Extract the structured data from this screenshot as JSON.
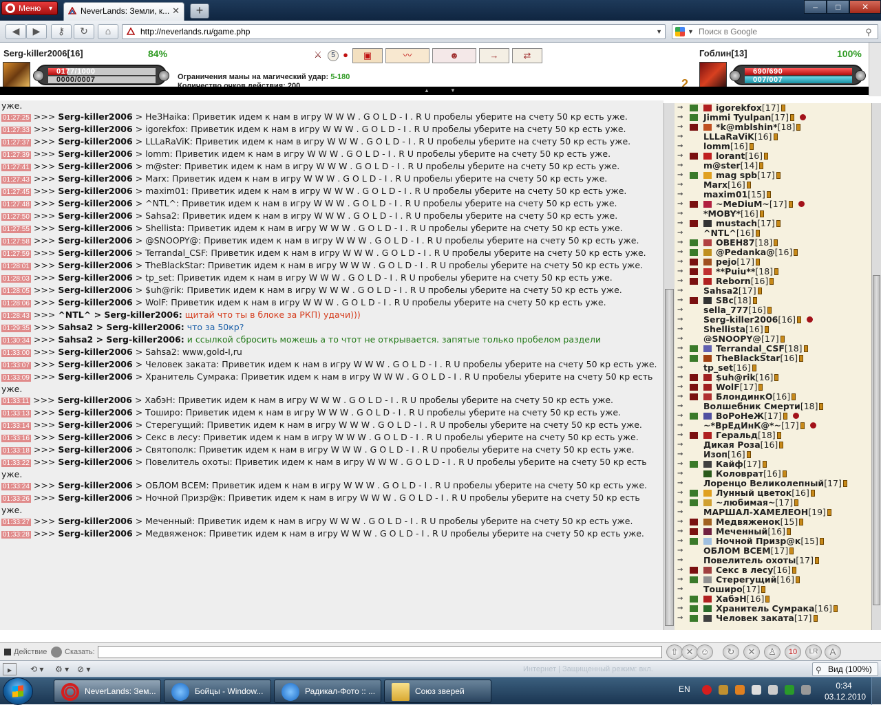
{
  "browser": {
    "menu_label": "Меню",
    "tab_title": "NeverLands: Земли, к...",
    "url": "http://neverlands.ru/game.php",
    "search_placeholder": "Поиск в Google",
    "zoom_label": "Вид (100%)"
  },
  "game": {
    "player": {
      "name": "Serg-killer2006[16]",
      "percent": "84%",
      "hp": "0177/1000",
      "mana": "0000/0007",
      "hp_fraction": 0.18,
      "mana_fraction": 0.0
    },
    "opponent": {
      "name": "Гоблин[13]",
      "percent": "100%",
      "hp": "690/690",
      "mana": "007/007",
      "hp_fraction": 1.0,
      "mana_fraction": 1.0
    },
    "mana_limit_label": "Ограничения маны на магический удар:",
    "mana_limit_value": "5-180",
    "action_points_label": "Количество очков действия: 200",
    "turn_marker": "2",
    "icons": [
      "crossed-swords-icon",
      "round-5-icon",
      "blood-drop-icon",
      "chest-icon",
      "horn-icon",
      "mask-icon",
      "arrow-icon",
      "swap-icon"
    ]
  },
  "chat": {
    "messages": [
      {
        "time": "",
        "sender": "",
        "body": "уже."
      },
      {
        "time": "01:27:25",
        "sender": "Serg-killer2006",
        "body": "> HeЗHaika: Приветик идем к нам в игру W W W . G O L D - I . R U пробелы уберите на счету 50 кр есть уже.",
        "color": ""
      },
      {
        "time": "01:27:33",
        "sender": "Serg-killer2006",
        "body": "> igorekfox: Приветик идем к нам в игру W W W . G O L D - I . R U пробелы уберите на счету 50 кр есть уже.",
        "color": ""
      },
      {
        "time": "01:27:37",
        "sender": "Serg-killer2006",
        "body": "> LLLaRaViK: Приветик идем к нам в игру W W W . G O L D - I . R U пробелы уберите на счету 50 кр есть уже.",
        "color": ""
      },
      {
        "time": "01:27:39",
        "sender": "Serg-killer2006",
        "body": "> lomm: Приветик идем к нам в игру W W W . G O L D - I . R U пробелы уберите на счету 50 кр есть уже.",
        "color": ""
      },
      {
        "time": "01:27:41",
        "sender": "Serg-killer2006",
        "body": "> m@ster: Приветик идем к нам в игру W W W . G O L D - I . R U пробелы уберите на счету 50 кр есть уже.",
        "color": ""
      },
      {
        "time": "01:27:43",
        "sender": "Serg-killer2006",
        "body": "> Marx: Приветик идем к нам в игру W W W . G O L D - I . R U пробелы уберите на счету 50 кр есть уже.",
        "color": ""
      },
      {
        "time": "01:27:45",
        "sender": "Serg-killer2006",
        "body": "> maxim01: Приветик идем к нам в игру W W W . G O L D - I . R U пробелы уберите на счету 50 кр есть уже.",
        "color": ""
      },
      {
        "time": "01:27:48",
        "sender": "Serg-killer2006",
        "body": "> ^NTL^: Приветик идем к нам в игру W W W . G O L D - I . R U пробелы уберите на счету 50 кр есть уже.",
        "color": ""
      },
      {
        "time": "01:27:50",
        "sender": "Serg-killer2006",
        "body": "> Sahsa2: Приветик идем к нам в игру W W W . G O L D - I . R U пробелы уберите на счету 50 кр есть уже.",
        "color": ""
      },
      {
        "time": "01:27:55",
        "sender": "Serg-killer2006",
        "body": "> Shellista: Приветик идем к нам в игру W W W . G O L D - I . R U пробелы уберите на счету 50 кр есть уже.",
        "color": ""
      },
      {
        "time": "01:27:58",
        "sender": "Serg-killer2006",
        "body": "> @SNOOPY@: Приветик идем к нам в игру W W W . G O L D - I . R U пробелы уберите на счету 50 кр есть уже.",
        "color": ""
      },
      {
        "time": "01:27:59",
        "sender": "Serg-killer2006",
        "body": "> Terrandal_CSF: Приветик идем к нам в игру W W W . G O L D - I . R U пробелы уберите на счету 50 кр есть уже.",
        "color": ""
      },
      {
        "time": "01:28:01",
        "sender": "Serg-killer2006",
        "body": "> TheBlackStar: Приветик идем к нам в игру W W W . G O L D - I . R U пробелы уберите на счету 50 кр есть уже.",
        "color": ""
      },
      {
        "time": "01:28:03",
        "sender": "Serg-killer2006",
        "body": "> tp_set: Приветик идем к нам в игру W W W . G O L D - I . R U пробелы уберите на счету 50 кр есть уже.",
        "color": ""
      },
      {
        "time": "01:28:05",
        "sender": "Serg-killer2006",
        "body": "> $uh@rik: Приветик идем к нам в игру W W W . G O L D - I . R U пробелы уберите на счету 50 кр есть уже.",
        "color": ""
      },
      {
        "time": "01:28:06",
        "sender": "Serg-killer2006",
        "body": "> WolF: Приветик идем к нам в игру W W W . G O L D - I . R U пробелы уберите на счету 50 кр есть уже.",
        "color": ""
      },
      {
        "time": "01:28:43",
        "sender": "^NTL^ > Serg-killer2006:",
        "body": "щитай что ты в блоке за РКП) удачи)))",
        "color": "red"
      },
      {
        "time": "01:29:35",
        "sender": "Sahsa2 > Serg-killer2006:",
        "body": "что за 50кр?",
        "color": "blue"
      },
      {
        "time": "01:30:34",
        "sender": "Sahsa2 > Serg-killer2006:",
        "body": "и ссылкой сбросить можешь а то чтот не открывается. запятые только пробелом раздели",
        "color": "green"
      },
      {
        "time": "01:33:00",
        "sender": "Serg-killer2006",
        "body": "> Sahsa2: www,gold-I,ru",
        "color": ""
      },
      {
        "time": "01:33:07",
        "sender": "Serg-killer2006",
        "body": "> Человек заката: Приветик идем к нам в игру W W W . G O L D - I . R U пробелы уберите на счету 50 кр есть уже.",
        "color": ""
      },
      {
        "time": "01:33:09",
        "sender": "Serg-killer2006",
        "body": "> Хранитель Сумрака: Приветик идем к нам в игру W W W . G O L D - I . R U пробелы уберите на счету 50 кр есть уже.",
        "color": ""
      },
      {
        "time": "01:33:11",
        "sender": "Serg-killer2006",
        "body": "> ХабэН: Приветик идем к нам в игру W W W . G O L D - I . R U пробелы уберите на счету 50 кр есть уже.",
        "color": ""
      },
      {
        "time": "01:33:13",
        "sender": "Serg-killer2006",
        "body": "> Тоширо: Приветик идем к нам в игру W W W . G O L D - I . R U пробелы уберите на счету 50 кр есть уже.",
        "color": ""
      },
      {
        "time": "01:33:14",
        "sender": "Serg-killer2006",
        "body": "> Стерегущий: Приветик идем к нам в игру W W W . G O L D - I . R U пробелы уберите на счету 50 кр есть уже.",
        "color": ""
      },
      {
        "time": "01:33:16",
        "sender": "Serg-killer2006",
        "body": "> Секс в лесу: Приветик идем к нам в игру W W W . G O L D - I . R U пробелы уберите на счету 50 кр есть уже.",
        "color": ""
      },
      {
        "time": "01:33:18",
        "sender": "Serg-killer2006",
        "body": "> Святополк: Приветик идем к нам в игру W W W . G O L D - I . R U пробелы уберите на счету 50 кр есть уже.",
        "color": ""
      },
      {
        "time": "01:33:22",
        "sender": "Serg-killer2006",
        "body": "> Повелитель охоты: Приветик идем к нам в игру W W W . G O L D - I . R U пробелы уберите на счету 50 кр есть уже.",
        "color": ""
      },
      {
        "time": "01:33:24",
        "sender": "Serg-killer2006",
        "body": "> ОБЛОМ ВСЕМ: Приветик идем к нам в игру W W W . G O L D - I . R U пробелы уберите на счету 50 кр есть уже.",
        "color": ""
      },
      {
        "time": "01:33:26",
        "sender": "Serg-killer2006",
        "body": "> Ночной Призр@к: Приветик идем к нам в игру W W W . G O L D - I . R U пробелы уберите на счету 50 кр есть уже.",
        "color": ""
      },
      {
        "time": "01:33:27",
        "sender": "Serg-killer2006",
        "body": "> Меченный: Приветик идем к нам в игру W W W . G O L D - I . R U пробелы уберите на счету 50 кр есть уже.",
        "color": ""
      },
      {
        "time": "01:33:28",
        "sender": "Serg-killer2006",
        "body": "> Медвяженок: Приветик идем к нам в игру W W W . G O L D - I . R U пробелы уберите на счету 50 кр есть уже.",
        "color": ""
      }
    ],
    "action_label": "Действие",
    "say_label": "Сказать:"
  },
  "users": [
    {
      "name": "igorekfox",
      "lvl": "[17]",
      "c1": "#3a7a2a",
      "c2": "#b02020"
    },
    {
      "name": "Jimmi Tyulpan",
      "lvl": "[17]",
      "c1": "#3a7a2a",
      "c2": "",
      "extra": true
    },
    {
      "name": "*k@mblshin*",
      "lvl": "[18]",
      "c1": "#7a1010",
      "c2": "#c05020"
    },
    {
      "name": "LLLaRaViK",
      "lvl": "[16]",
      "c1": "",
      "c2": ""
    },
    {
      "name": "lomm",
      "lvl": "[16]",
      "c1": "",
      "c2": ""
    },
    {
      "name": "lorant",
      "lvl": "[16]",
      "c1": "#7a1010",
      "c2": "#c02020"
    },
    {
      "name": "m@ster",
      "lvl": "[14]",
      "c1": "",
      "c2": ""
    },
    {
      "name": "mag spb",
      "lvl": "[17]",
      "c1": "#3a7a2a",
      "c2": "#e0a020"
    },
    {
      "name": "Marx",
      "lvl": "[16]",
      "c1": "",
      "c2": ""
    },
    {
      "name": "maxim01",
      "lvl": "[15]",
      "c1": "",
      "c2": ""
    },
    {
      "name": "~MeDiuM~",
      "lvl": "[17]",
      "c1": "#7a1010",
      "c2": "#b02040",
      "extra": true
    },
    {
      "name": "*MOBY*",
      "lvl": "[16]",
      "c1": "",
      "c2": ""
    },
    {
      "name": "mustach",
      "lvl": "[17]",
      "c1": "#7a1010",
      "c2": "#333333"
    },
    {
      "name": "^NTL^",
      "lvl": "[16]",
      "c1": "",
      "c2": ""
    },
    {
      "name": "OBEH87",
      "lvl": "[18]",
      "c1": "#3a7a2a",
      "c2": "#b04040"
    },
    {
      "name": "@Pedanka@",
      "lvl": "[16]",
      "c1": "#3a7a2a",
      "c2": "#c09020"
    },
    {
      "name": "pejo",
      "lvl": "[17]",
      "c1": "#7a1010",
      "c2": "#a05020"
    },
    {
      "name": "**Puiu**",
      "lvl": "[18]",
      "c1": "#7a1010",
      "c2": "#c03030"
    },
    {
      "name": "Reborn",
      "lvl": "[16]",
      "c1": "#7a1010",
      "c2": "#b02020"
    },
    {
      "name": "Sahsa2",
      "lvl": "[17]",
      "c1": "",
      "c2": ""
    },
    {
      "name": "SBc",
      "lvl": "[18]",
      "c1": "#7a1010",
      "c2": "#333333"
    },
    {
      "name": "sella_777",
      "lvl": "[16]",
      "c1": "",
      "c2": ""
    },
    {
      "name": "Serg-killer2006",
      "lvl": "[16]",
      "c1": "",
      "c2": "",
      "extra": true
    },
    {
      "name": "Shellista",
      "lvl": "[16]",
      "c1": "",
      "c2": ""
    },
    {
      "name": "@SNOOPY@",
      "lvl": "[17]",
      "c1": "",
      "c2": ""
    },
    {
      "name": "Terrandal_CSF",
      "lvl": "[18]",
      "c1": "#3a7a2a",
      "c2": "#6060b0"
    },
    {
      "name": "TheBlackStar",
      "lvl": "[16]",
      "c1": "#3a7a2a",
      "c2": "#a04010"
    },
    {
      "name": "tp_set",
      "lvl": "[16]",
      "c1": "",
      "c2": ""
    },
    {
      "name": "$uh@rik",
      "lvl": "[16]",
      "c1": "#7a1010",
      "c2": "#a02020"
    },
    {
      "name": "WolF",
      "lvl": "[17]",
      "c1": "#7a1010",
      "c2": "#a02020"
    },
    {
      "name": "БлондинкО",
      "lvl": "[16]",
      "c1": "#7a1010",
      "c2": "#b03030"
    },
    {
      "name": "Волшебник Смерти",
      "lvl": "[18]",
      "c1": "",
      "c2": ""
    },
    {
      "name": "ВоРоНеЖ",
      "lvl": "[17]",
      "c1": "#3a7a2a",
      "c2": "#5050a0",
      "extra": true
    },
    {
      "name": "~*ВрЕдИнК@*~",
      "lvl": "[17]",
      "c1": "",
      "c2": "",
      "extra": true
    },
    {
      "name": "Геральд",
      "lvl": "[18]",
      "c1": "#7a1010",
      "c2": "#b02020"
    },
    {
      "name": "Дикая Роза",
      "lvl": "[16]",
      "c1": "",
      "c2": ""
    },
    {
      "name": "Изоп",
      "lvl": "[16]",
      "c1": "",
      "c2": ""
    },
    {
      "name": "Кайф",
      "lvl": "[17]",
      "c1": "#3a7a2a",
      "c2": "#404040"
    },
    {
      "name": "Коловрат",
      "lvl": "[16]",
      "c1": "",
      "c2": "#2a5a1a"
    },
    {
      "name": "Лоренцо Великолепный",
      "lvl": "[17]",
      "c1": "",
      "c2": ""
    },
    {
      "name": "Лунный цветок",
      "lvl": "[16]",
      "c1": "#3a7a2a",
      "c2": "#e0a020"
    },
    {
      "name": "~любимая~",
      "lvl": "[17]",
      "c1": "#3a7a2a",
      "c2": "#d0a030"
    },
    {
      "name": "МАРШАЛ-ХАМЕЛЕОН",
      "lvl": "[19]",
      "c1": "",
      "c2": ""
    },
    {
      "name": "Медвяженок",
      "lvl": "[15]",
      "c1": "#7a1010",
      "c2": "#a06020"
    },
    {
      "name": "Меченный",
      "lvl": "[16]",
      "c1": "#7a1010",
      "c2": "#702040"
    },
    {
      "name": "Ночной Призр@к",
      "lvl": "[15]",
      "c1": "#3a7a2a",
      "c2": "#a0c0e0"
    },
    {
      "name": "ОБЛОМ ВСЕМ",
      "lvl": "[17]",
      "c1": "",
      "c2": ""
    },
    {
      "name": "Повелитель охоты",
      "lvl": "[17]",
      "c1": "",
      "c2": ""
    },
    {
      "name": "Секс в лесу",
      "lvl": "[16]",
      "c1": "#7a1010",
      "c2": "#a04040"
    },
    {
      "name": "Стерегущий",
      "lvl": "[16]",
      "c1": "#3a7a2a",
      "c2": "#909090"
    },
    {
      "name": "Тоширо",
      "lvl": "[17]",
      "c1": "",
      "c2": ""
    },
    {
      "name": "ХабэН",
      "lvl": "[16]",
      "c1": "#3a7a2a",
      "c2": "#b02020"
    },
    {
      "name": "Хранитель Сумрака",
      "lvl": "[16]",
      "c1": "#3a7a2a",
      "c2": "#2a6a2a"
    },
    {
      "name": "Человек заката",
      "lvl": "[17]",
      "c1": "#3a7a2a",
      "c2": "#404040"
    }
  ],
  "statusbar": {
    "faded_text": "Интернет | Защищенный режим: вкл."
  },
  "taskbar": {
    "items": [
      {
        "label": "NeverLands: Зем...",
        "icon": "opera-icon"
      },
      {
        "label": "Бойцы - Window...",
        "icon": "ie-icon"
      },
      {
        "label": "Радикал-Фото :: ...",
        "icon": "ie-icon"
      },
      {
        "label": "Союз зверей",
        "icon": "folder-icon"
      }
    ],
    "lang": "EN",
    "time": "0:34",
    "date": "03.12.2010"
  }
}
